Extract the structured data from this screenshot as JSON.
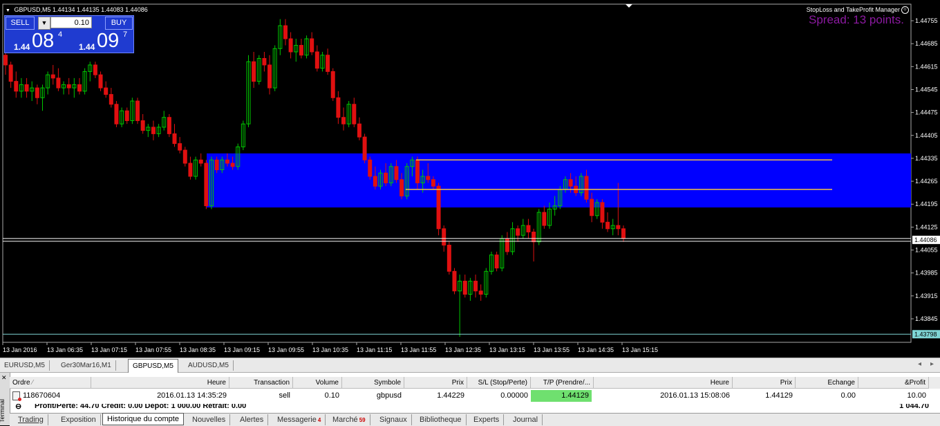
{
  "chart": {
    "title": "GBPUSD,M5",
    "ohlc": [
      "1.44134",
      "1.44135",
      "1.44083",
      "1.44086"
    ],
    "ea_label": "StopLoss and TakeProfit Manager",
    "spread_label": "Spread: 13 points.",
    "y_ticks": [
      "1.44755",
      "1.44685",
      "1.44615",
      "1.44545",
      "1.44475",
      "1.44405",
      "1.44335",
      "1.44265",
      "1.44195",
      "1.44125",
      "1.44055",
      "1.43985",
      "1.43915",
      "1.43845"
    ],
    "y_range": [
      1.43785,
      1.44785
    ],
    "current_price": "1.44086",
    "low_marker": "1.43798",
    "x_ticks": [
      "13 Jan 2016",
      "13 Jan 06:35",
      "13 Jan 07:15",
      "13 Jan 07:55",
      "13 Jan 08:35",
      "13 Jan 09:15",
      "13 Jan 09:55",
      "13 Jan 10:35",
      "13 Jan 11:15",
      "13 Jan 11:55",
      "13 Jan 12:35",
      "13 Jan 13:15",
      "13 Jan 13:55",
      "13 Jan 14:35",
      "13 Jan 15:15"
    ],
    "zone_price": [
      1.44185,
      1.4435
    ],
    "sl_line": 1.4433,
    "tp_line": 1.4424,
    "colors": {
      "bull": "#00c800",
      "bear": "#e01010",
      "zone": "#0000ff",
      "level": "#f5c542",
      "grid": "#aaaaaa",
      "low_line": "#7fd6d6"
    }
  },
  "trade_panel": {
    "sell_label": "SELL",
    "buy_label": "BUY",
    "volume": "0.10",
    "bid_small": "1.44",
    "bid_big": "08",
    "bid_sup": "4",
    "ask_small": "1.44",
    "ask_big": "09",
    "ask_sup": "7"
  },
  "chart_tabs": [
    "EURUSD,M5",
    "Ger30Mar16,M1",
    "GBPUSD,M5",
    "AUDUSD,M5"
  ],
  "chart_tabs_active": "GBPUSD,M5",
  "terminal": {
    "label": "Terminal",
    "columns": [
      "Ordre",
      "Heure",
      "Transaction",
      "Volume",
      "Symbole",
      "Prix",
      "S/L (Stop/Perte)",
      "T/P (Prendre/...",
      "Heure",
      "Prix",
      "Echange",
      "&Profit"
    ],
    "row": [
      "118670604",
      "2016.01.13 14:35:29",
      "sell",
      "0.10",
      "gbpusd",
      "1.44229",
      "0.00000",
      "1.44129",
      "2016.01.13 15:08:06",
      "1.44129",
      "0.00",
      "10.00"
    ],
    "summary": "Profit/Perte: 44.70  Crédit: 0.00  Dépôt: 1 000.00  Retrait: 0.00",
    "summary_total": "1 044.70"
  },
  "bottom_tabs": [
    {
      "label": "Trading",
      "badge": ""
    },
    {
      "label": "Exposition",
      "badge": ""
    },
    {
      "label": "Historique du compte",
      "badge": ""
    },
    {
      "label": "Nouvelles",
      "badge": ""
    },
    {
      "label": "Alertes",
      "badge": ""
    },
    {
      "label": "Messagerie",
      "badge": "4"
    },
    {
      "label": "Marché",
      "badge": "59"
    },
    {
      "label": "Signaux",
      "badge": ""
    },
    {
      "label": "Bibliotheque",
      "badge": ""
    },
    {
      "label": "Experts",
      "badge": ""
    },
    {
      "label": "Journal",
      "badge": ""
    }
  ],
  "bottom_tabs_active": "Historique du compte",
  "chart_data": {
    "type": "candlestick",
    "title": "GBPUSD,M5",
    "ylim": [
      1.43785,
      1.44785
    ],
    "candles": [
      [
        1.4465,
        1.4466,
        1.4459,
        1.4462
      ],
      [
        1.4462,
        1.4463,
        1.4455,
        1.4457
      ],
      [
        1.4457,
        1.446,
        1.4452,
        1.4454
      ],
      [
        1.4454,
        1.4458,
        1.4452,
        1.4456
      ],
      [
        1.4456,
        1.4458,
        1.4452,
        1.4454
      ],
      [
        1.4454,
        1.4457,
        1.4451,
        1.4455
      ],
      [
        1.4455,
        1.4456,
        1.445,
        1.4452
      ],
      [
        1.4452,
        1.4456,
        1.4448,
        1.4455
      ],
      [
        1.4455,
        1.446,
        1.4453,
        1.4459
      ],
      [
        1.4459,
        1.4462,
        1.4456,
        1.4458
      ],
      [
        1.4458,
        1.4461,
        1.4454,
        1.4455
      ],
      [
        1.4455,
        1.4457,
        1.4453,
        1.4456
      ],
      [
        1.4456,
        1.4458,
        1.4453,
        1.4455
      ],
      [
        1.4455,
        1.4458,
        1.4452,
        1.4456
      ],
      [
        1.4456,
        1.4458,
        1.4453,
        1.4454
      ],
      [
        1.4454,
        1.4461,
        1.4453,
        1.446
      ],
      [
        1.446,
        1.4463,
        1.4457,
        1.4462
      ],
      [
        1.4462,
        1.4463,
        1.4458,
        1.4459
      ],
      [
        1.4459,
        1.446,
        1.4454,
        1.4455
      ],
      [
        1.4455,
        1.4457,
        1.4452,
        1.4453
      ],
      [
        1.4453,
        1.4455,
        1.4449,
        1.445
      ],
      [
        1.445,
        1.4451,
        1.4443,
        1.4444
      ],
      [
        1.4444,
        1.4449,
        1.4443,
        1.4448
      ],
      [
        1.4448,
        1.4449,
        1.4444,
        1.4445
      ],
      [
        1.4445,
        1.4452,
        1.4444,
        1.4451
      ],
      [
        1.4451,
        1.4452,
        1.4444,
        1.4445
      ],
      [
        1.4445,
        1.4447,
        1.4441,
        1.4442
      ],
      [
        1.4442,
        1.4444,
        1.444,
        1.4443
      ],
      [
        1.4443,
        1.4445,
        1.4439,
        1.4441
      ],
      [
        1.4441,
        1.4444,
        1.444,
        1.4443
      ],
      [
        1.4443,
        1.4448,
        1.4442,
        1.4446
      ],
      [
        1.4446,
        1.4447,
        1.444,
        1.4441
      ],
      [
        1.4441,
        1.4444,
        1.4437,
        1.4438
      ],
      [
        1.4438,
        1.444,
        1.4435,
        1.4436
      ],
      [
        1.4436,
        1.4437,
        1.4431,
        1.4432
      ],
      [
        1.4432,
        1.4434,
        1.4427,
        1.4428
      ],
      [
        1.4428,
        1.4434,
        1.4427,
        1.4433
      ],
      [
        1.4433,
        1.4435,
        1.4431,
        1.4432
      ],
      [
        1.4432,
        1.4433,
        1.4418,
        1.4419
      ],
      [
        1.4419,
        1.4434,
        1.4418,
        1.4433
      ],
      [
        1.4433,
        1.4434,
        1.4429,
        1.443
      ],
      [
        1.443,
        1.4434,
        1.4429,
        1.4433
      ],
      [
        1.4433,
        1.4435,
        1.4431,
        1.4432
      ],
      [
        1.4432,
        1.4434,
        1.443,
        1.4431
      ],
      [
        1.4431,
        1.4438,
        1.443,
        1.4437
      ],
      [
        1.4437,
        1.4445,
        1.4436,
        1.4444
      ],
      [
        1.4444,
        1.4465,
        1.4443,
        1.4463
      ],
      [
        1.4463,
        1.4466,
        1.4455,
        1.4457
      ],
      [
        1.4457,
        1.4465,
        1.4456,
        1.4464
      ],
      [
        1.4464,
        1.4466,
        1.446,
        1.4462
      ],
      [
        1.4462,
        1.4465,
        1.4453,
        1.4455
      ],
      [
        1.4455,
        1.4468,
        1.4454,
        1.4467
      ],
      [
        1.4467,
        1.4476,
        1.4465,
        1.4474
      ],
      [
        1.4474,
        1.4476,
        1.4468,
        1.447
      ],
      [
        1.447,
        1.4472,
        1.4464,
        1.4466
      ],
      [
        1.4466,
        1.447,
        1.4463,
        1.4468
      ],
      [
        1.4468,
        1.447,
        1.4464,
        1.4465
      ],
      [
        1.4465,
        1.4471,
        1.4464,
        1.447
      ],
      [
        1.447,
        1.4472,
        1.4465,
        1.4466
      ],
      [
        1.4466,
        1.4468,
        1.446,
        1.4461
      ],
      [
        1.4461,
        1.4466,
        1.446,
        1.4465
      ],
      [
        1.4465,
        1.4467,
        1.4459,
        1.446
      ],
      [
        1.446,
        1.4461,
        1.4451,
        1.4452
      ],
      [
        1.4452,
        1.4454,
        1.4444,
        1.4446
      ],
      [
        1.4446,
        1.4449,
        1.4442,
        1.4444
      ],
      [
        1.4444,
        1.4451,
        1.4443,
        1.445
      ],
      [
        1.445,
        1.4452,
        1.4443,
        1.4444
      ],
      [
        1.4444,
        1.4446,
        1.4439,
        1.444
      ],
      [
        1.444,
        1.4441,
        1.4432,
        1.4433
      ],
      [
        1.4433,
        1.4434,
        1.4427,
        1.4428
      ],
      [
        1.4428,
        1.4431,
        1.4424,
        1.4425
      ],
      [
        1.4425,
        1.443,
        1.4424,
        1.4429
      ],
      [
        1.4429,
        1.4432,
        1.4425,
        1.4426
      ],
      [
        1.4426,
        1.4432,
        1.4425,
        1.4431
      ],
      [
        1.4431,
        1.4433,
        1.4426,
        1.4427
      ],
      [
        1.4427,
        1.4429,
        1.4421,
        1.4422
      ],
      [
        1.4422,
        1.4432,
        1.4421,
        1.4431
      ],
      [
        1.4431,
        1.4434,
        1.4428,
        1.4433
      ],
      [
        1.4433,
        1.4434,
        1.4424,
        1.4426
      ],
      [
        1.4426,
        1.443,
        1.4423,
        1.4428
      ],
      [
        1.4428,
        1.4432,
        1.4426,
        1.4427
      ],
      [
        1.4427,
        1.4428,
        1.4424,
        1.4425
      ],
      [
        1.4425,
        1.4426,
        1.441,
        1.4412
      ],
      [
        1.4412,
        1.4413,
        1.4405,
        1.4407
      ],
      [
        1.4407,
        1.4408,
        1.4398,
        1.4399
      ],
      [
        1.4399,
        1.44,
        1.4392,
        1.4393
      ],
      [
        1.4393,
        1.4398,
        1.4379,
        1.4396
      ],
      [
        1.4396,
        1.4398,
        1.4391,
        1.4392
      ],
      [
        1.4392,
        1.4397,
        1.439,
        1.4396
      ],
      [
        1.4396,
        1.4398,
        1.4391,
        1.4393
      ],
      [
        1.4393,
        1.4395,
        1.439,
        1.4392
      ],
      [
        1.4392,
        1.44,
        1.4391,
        1.4399
      ],
      [
        1.4399,
        1.4405,
        1.4398,
        1.4404
      ],
      [
        1.4404,
        1.4405,
        1.4399,
        1.44
      ],
      [
        1.44,
        1.441,
        1.4399,
        1.4409
      ],
      [
        1.4409,
        1.4411,
        1.4404,
        1.4405
      ],
      [
        1.4405,
        1.4414,
        1.4404,
        1.4412
      ],
      [
        1.4412,
        1.4413,
        1.4408,
        1.441
      ],
      [
        1.441,
        1.4415,
        1.4409,
        1.4413
      ],
      [
        1.4413,
        1.4415,
        1.4409,
        1.4411
      ],
      [
        1.4411,
        1.4412,
        1.4402,
        1.4408
      ],
      [
        1.4408,
        1.4418,
        1.4407,
        1.4417
      ],
      [
        1.4417,
        1.4419,
        1.4412,
        1.4413
      ],
      [
        1.4413,
        1.442,
        1.4412,
        1.4418
      ],
      [
        1.4418,
        1.4422,
        1.4416,
        1.4419
      ],
      [
        1.4419,
        1.4425,
        1.4418,
        1.4424
      ],
      [
        1.4424,
        1.4428,
        1.4423,
        1.4427
      ],
      [
        1.4427,
        1.4429,
        1.4423,
        1.4425
      ],
      [
        1.4425,
        1.4428,
        1.4422,
        1.4423
      ],
      [
        1.4423,
        1.4429,
        1.4422,
        1.4428
      ],
      [
        1.4428,
        1.443,
        1.442,
        1.4421
      ],
      [
        1.4421,
        1.4423,
        1.4414,
        1.4416
      ],
      [
        1.4416,
        1.4421,
        1.4415,
        1.442
      ],
      [
        1.442,
        1.4421,
        1.4412,
        1.4414
      ],
      [
        1.4414,
        1.4417,
        1.4411,
        1.4412
      ],
      [
        1.4412,
        1.4415,
        1.441,
        1.4413
      ],
      [
        1.4413,
        1.4426,
        1.441,
        1.4412
      ],
      [
        1.4412,
        1.4413,
        1.4408,
        1.4409
      ]
    ]
  }
}
